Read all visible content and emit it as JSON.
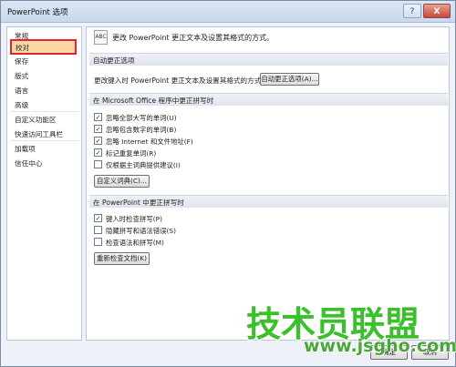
{
  "window": {
    "title": "PowerPoint 选项",
    "help": "?",
    "close": "X"
  },
  "sidebar": {
    "items": [
      "常规",
      "校对",
      "保存",
      "版式",
      "语言",
      "高级",
      "自定义功能区",
      "快速访问工具栏",
      "加载项",
      "信任中心"
    ],
    "selected": "校对"
  },
  "main": {
    "header": {
      "icon": "ABC",
      "text": "更改 PowerPoint 更正文本及设置其格式的方式。"
    },
    "autocorrect": {
      "section": "自动更正选项",
      "desc": "更改键入时 PowerPoint 更正文本及设置其格式的方式：",
      "button": "自动更正选项(A)..."
    },
    "office_spelling": {
      "section": "在 Microsoft Office 程序中更正拼写时",
      "options": [
        {
          "label": "忽略全部大写的单词(U)",
          "checked": true
        },
        {
          "label": "忽略包含数字的单词(B)",
          "checked": true
        },
        {
          "label": "忽略 Internet 和文件地址(F)",
          "checked": true
        },
        {
          "label": "标记重复单词(R)",
          "checked": true
        },
        {
          "label": "仅根据主词典提供建议(I)",
          "checked": false
        }
      ],
      "button": "自定义词典(C)..."
    },
    "ppt_spelling": {
      "section": "在 PowerPoint 中更正拼写时",
      "options": [
        {
          "label": "键入时检查拼写(P)",
          "checked": true
        },
        {
          "label": "隐藏拼写和语法错误(S)",
          "checked": false
        },
        {
          "label": "检查语法和拼写(M)",
          "checked": false
        }
      ],
      "button": "重新检查文档(K)"
    }
  },
  "footer": {
    "ok": "确定",
    "cancel": "取消"
  },
  "watermark": {
    "logo": "技术员联盟",
    "url": "www.jsgho.com"
  }
}
